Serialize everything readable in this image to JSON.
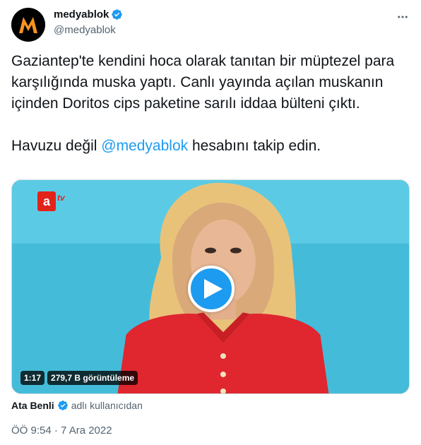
{
  "author": {
    "display_name": "medyablok",
    "handle": "@medyablok",
    "verified": true
  },
  "tweet": {
    "paragraph1": "Gaziantep'te kendini hoca olarak tanıtan bir müptezel para karşılığında muska yaptı. Canlı yayında açılan muskanın içinden Doritos cips paketine sarılı iddaa bülteni çıktı.",
    "paragraph2_before": "Havuzu değil ",
    "mention": "@medyablok",
    "paragraph2_after": " hesabını takip edin."
  },
  "media": {
    "channel_logo": "a",
    "channel_tv": "tv",
    "duration": "1:17",
    "views": "279,7 B görüntüleme"
  },
  "attribution": {
    "name": "Ata Benli",
    "suffix": "adlı kullanıcıdan"
  },
  "timestamp": "ÖÖ 9:54 · 7 Ara 2022",
  "icons": {
    "verified": "verified-badge-icon",
    "more": "more-dots-icon",
    "play": "play-icon"
  },
  "colors": {
    "accent": "#1d9bf0",
    "secondary_text": "#536471",
    "logo_orange": "#f7941d"
  }
}
